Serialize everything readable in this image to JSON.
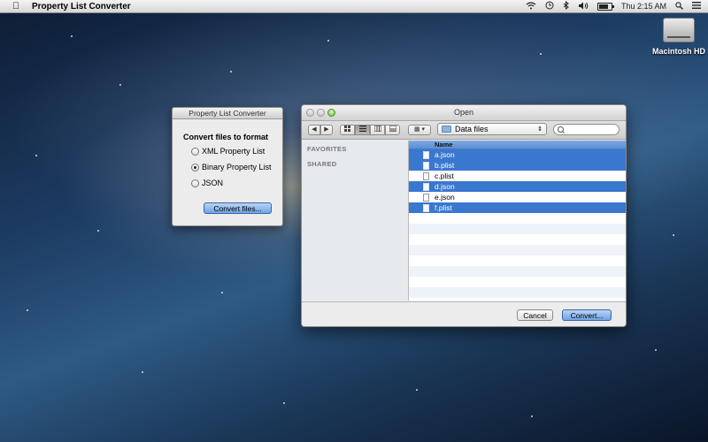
{
  "menubar": {
    "apple_icon": "apple-icon",
    "app_name": "Property List Converter",
    "status_icons": [
      "wifi-icon",
      "time-machine-icon",
      "bluetooth-icon",
      "volume-icon",
      "battery-icon"
    ],
    "clock": "Thu 2:15 AM",
    "battery_level": 0.8
  },
  "desktop": {
    "icon_label": "Macintosh HD"
  },
  "converter_panel": {
    "title": "Property List Converter",
    "heading": "Convert files to format",
    "options": [
      {
        "label": "XML Property List",
        "selected": false
      },
      {
        "label": "Binary Property List",
        "selected": true
      },
      {
        "label": "JSON",
        "selected": false
      }
    ],
    "button_label": "Convert files..."
  },
  "open_dialog": {
    "title": "Open",
    "toolbar": {
      "back_glyph": "◀",
      "forward_glyph": "▶",
      "view_modes": [
        "icon-view",
        "list-view",
        "column-view",
        "coverflow-view"
      ],
      "active_view": "list-view",
      "arrange_glyph": "▦ ▾",
      "location": "Data files",
      "search_placeholder": ""
    },
    "sidebar": {
      "favorites_label": "FAVORITES",
      "shared_label": "SHARED"
    },
    "column_header": "Name",
    "files": [
      {
        "name": "a.json",
        "selected": true
      },
      {
        "name": "b.plist",
        "selected": true
      },
      {
        "name": "c.plist",
        "selected": false
      },
      {
        "name": "d.json",
        "selected": true
      },
      {
        "name": "e.json",
        "selected": false
      },
      {
        "name": "f.plist",
        "selected": true
      }
    ],
    "cancel_label": "Cancel",
    "convert_label": "Convert..."
  },
  "colors": {
    "selection": "#3a77cf",
    "default_button": "#6fa3e3",
    "menubar": "#e6e6e6"
  }
}
